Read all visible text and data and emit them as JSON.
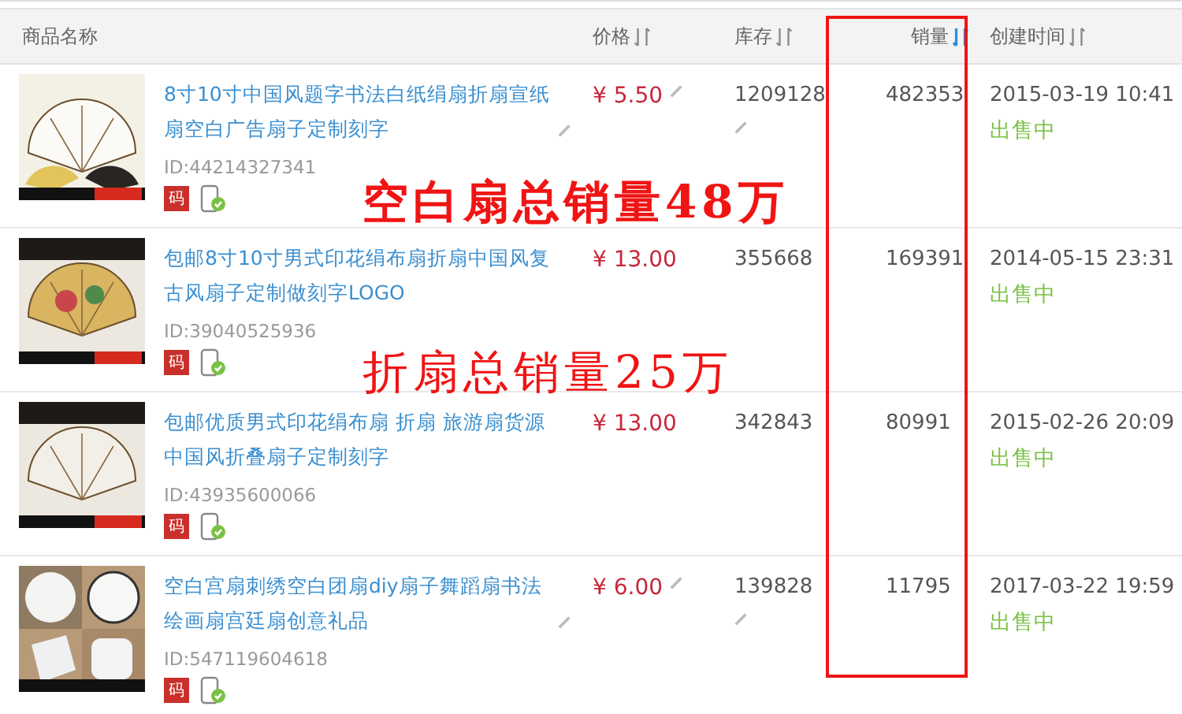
{
  "table": {
    "columns": [
      {
        "label": "商品名称"
      },
      {
        "label": "价格",
        "sorted": false
      },
      {
        "label": "库存",
        "sorted": false
      },
      {
        "label": "销量",
        "sorted": true
      },
      {
        "label": "创建时间",
        "sorted": false
      }
    ],
    "rows": [
      {
        "title": "8寸10寸中国风题字书法白纸绢扇折扇宣纸扇空白广告扇子定制刻字",
        "title_editable": true,
        "id": "ID:44214327341",
        "code_badge": "码",
        "price": "¥ 5.50",
        "price_editable": true,
        "stock": "1209128",
        "stock_editable": true,
        "sales": "482353",
        "created": "2015-03-19 10:41",
        "status": "出售中"
      },
      {
        "title": "包邮8寸10寸男式印花绢布扇折扇中国风复古风扇子定制做刻字LOGO",
        "title_editable": false,
        "id": "ID:39040525936",
        "code_badge": "码",
        "price": "¥ 13.00",
        "price_editable": false,
        "stock": "355668",
        "stock_editable": false,
        "sales": "169391",
        "created": "2014-05-15 23:31",
        "status": "出售中"
      },
      {
        "title": "包邮优质男式印花绢布扇 折扇 旅游扇货源中国风折叠扇子定制刻字",
        "title_editable": false,
        "id": "ID:43935600066",
        "code_badge": "码",
        "price": "¥ 13.00",
        "price_editable": false,
        "stock": "342843",
        "stock_editable": false,
        "sales": "80991",
        "created": "2015-02-26 20:09",
        "status": "出售中"
      },
      {
        "title": "空白宫扇刺绣空白团扇diy扇子舞蹈扇书法绘画扇宫廷扇创意礼品",
        "title_editable": true,
        "id": "ID:547119604618",
        "code_badge": "码",
        "price": "¥ 6.00",
        "price_editable": true,
        "stock": "139828",
        "stock_editable": true,
        "sales": "11795",
        "created": "2017-03-22 19:59",
        "status": "出售中"
      }
    ]
  },
  "annotations": [
    {
      "text": "空白扇总销量48万",
      "kind": "bold"
    },
    {
      "text": "折扇总销量25万",
      "kind": "serif"
    }
  ]
}
